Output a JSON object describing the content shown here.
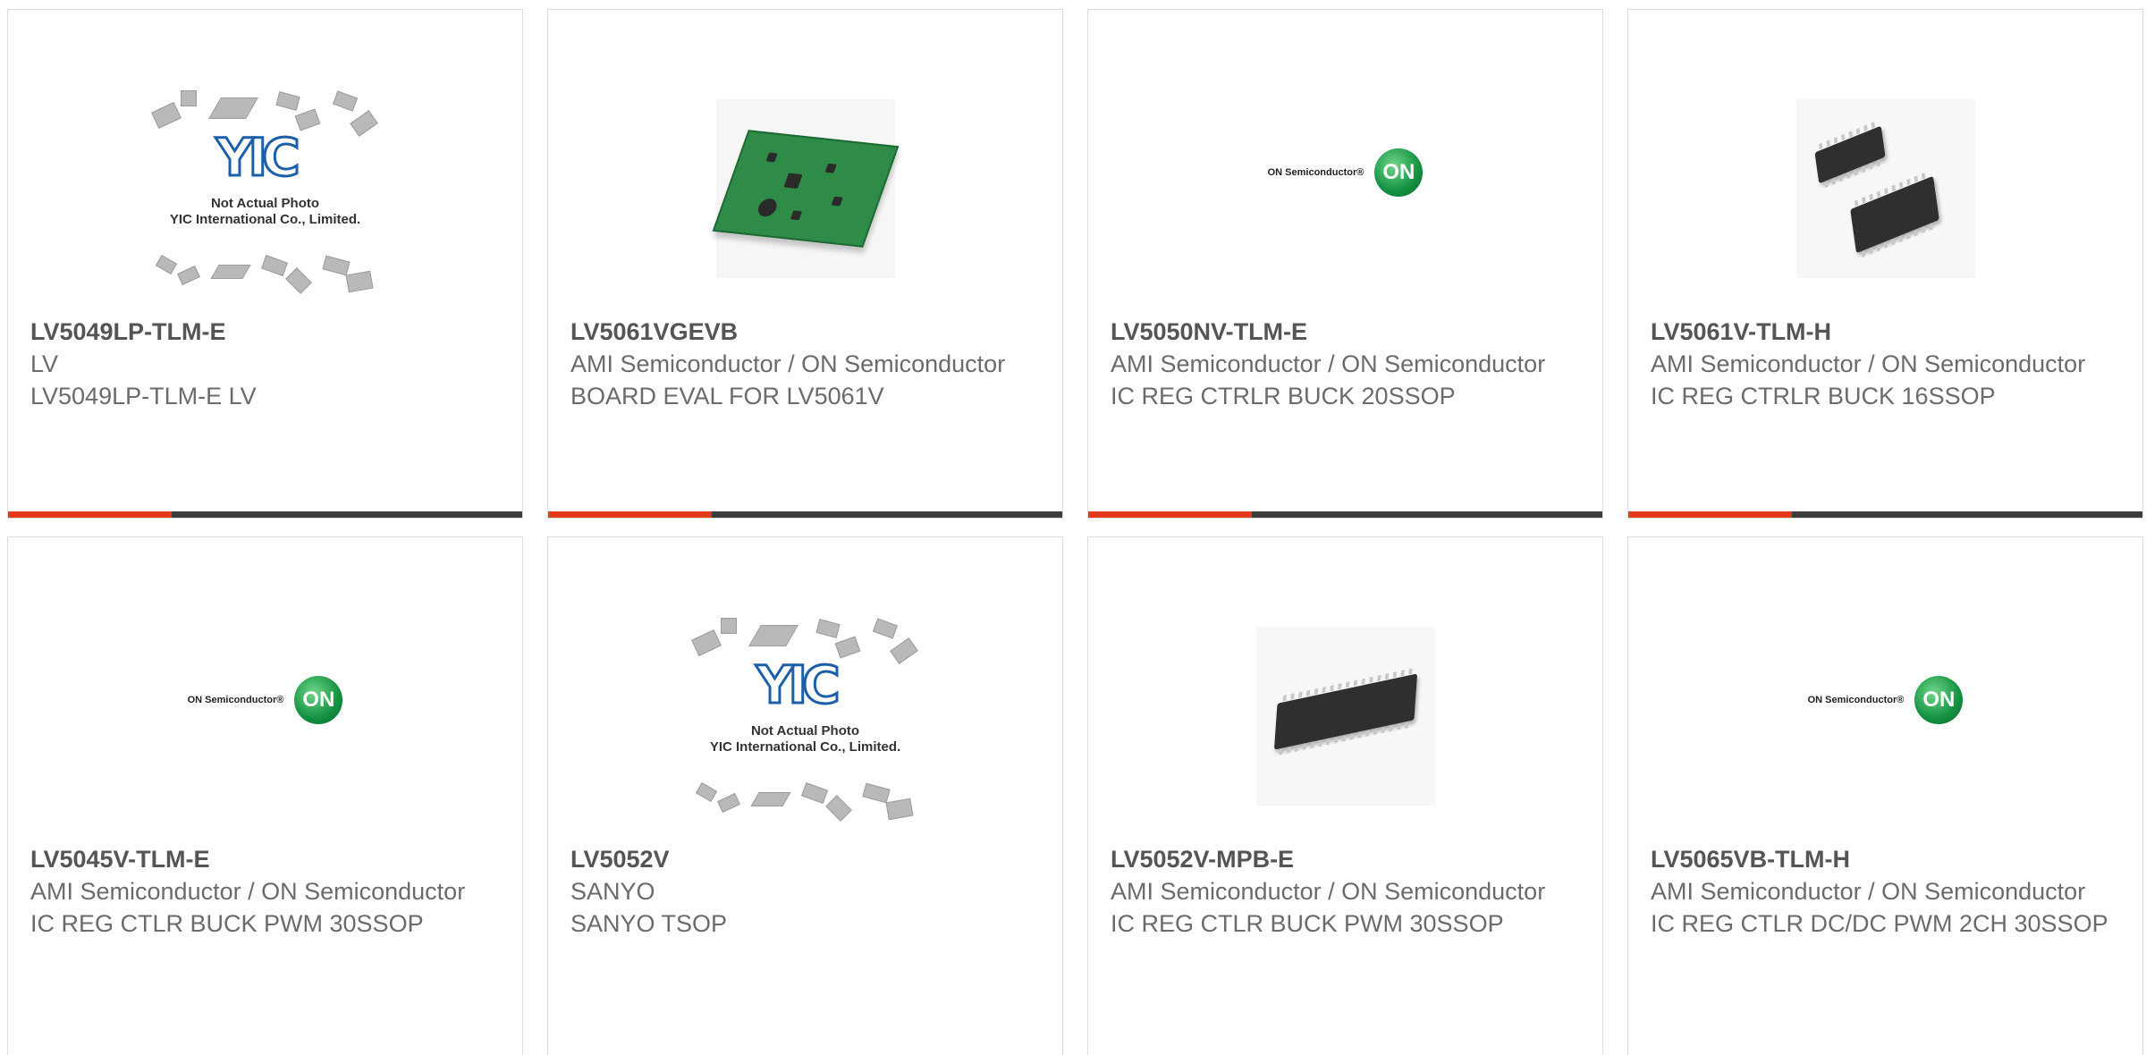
{
  "cards": [
    {
      "part": "LV5049LP-TLM-E",
      "maker": "LV",
      "desc": "LV5049LP-TLM-E LV",
      "image": "not-actual-photo-placeholder"
    },
    {
      "part": "LV5061VGEVB",
      "maker": "AMI Semiconductor / ON Semiconductor",
      "desc": "BOARD EVAL FOR LV5061V",
      "image": "eval-board-photo"
    },
    {
      "part": "LV5050NV-TLM-E",
      "maker": "AMI Semiconductor / ON Semiconductor",
      "desc": "IC REG CTRLR BUCK 20SSOP",
      "image": "on-semiconductor-logo"
    },
    {
      "part": "LV5061V-TLM-H",
      "maker": "AMI Semiconductor / ON Semiconductor",
      "desc": "IC REG CTRLR BUCK 16SSOP",
      "image": "ssop-chip-photo"
    },
    {
      "part": "LV5045V-TLM-E",
      "maker": "AMI Semiconductor / ON Semiconductor",
      "desc": "IC REG CTLR BUCK PWM 30SSOP",
      "image": "on-semiconductor-logo"
    },
    {
      "part": "LV5052V",
      "maker": "SANYO",
      "desc": "SANYO TSOP",
      "image": "not-actual-photo-placeholder"
    },
    {
      "part": "LV5052V-MPB-E",
      "maker": "AMI Semiconductor / ON Semiconductor",
      "desc": "IC REG CTLR BUCK PWM 30SSOP",
      "image": "ssop-chip-photo"
    },
    {
      "part": "LV5065VB-TLM-H",
      "maker": "AMI Semiconductor / ON Semiconductor",
      "desc": "IC REG CTLR DC/DC PWM 2CH 30SSOP",
      "image": "on-semiconductor-logo"
    }
  ],
  "placeholder": {
    "logo": "YIC",
    "caption_line1": "Not Actual Photo",
    "caption_line2": "YIC International Co., Limited."
  },
  "on_logo": {
    "word": "ON Semiconductor®",
    "disc": "ON"
  },
  "colors": {
    "accent": "#e23a1b",
    "bar": "#3d3d3d",
    "title": "#555555",
    "text": "#6b6b6b",
    "border": "#dcdcdc"
  }
}
